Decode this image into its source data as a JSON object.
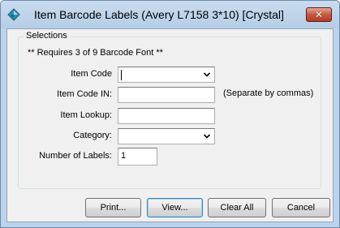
{
  "window": {
    "title": "Item Barcode Labels (Avery L7158 3*10)  [Crystal]",
    "close_glyph": "✕",
    "icon": "diamond-app-icon"
  },
  "group": {
    "title": "Selections",
    "note": "** Requires 3 of 9 Barcode Font **"
  },
  "fields": {
    "item_code": {
      "label": "Item Code",
      "value": ""
    },
    "item_code_in": {
      "label": "Item Code IN:",
      "value": "",
      "hint": "(Separate by commas)"
    },
    "item_lookup": {
      "label": "Item Lookup:",
      "value": ""
    },
    "category": {
      "label": "Category:",
      "value": ""
    },
    "number_of_labels": {
      "label": "Number of Labels:",
      "value": "1"
    }
  },
  "buttons": {
    "print": "Print...",
    "view": "View...",
    "clear_all": "Clear All",
    "cancel": "Cancel"
  },
  "colors": {
    "frame": "#bcd3ea",
    "client": "#f0f0f0",
    "close": "#c75a44"
  }
}
